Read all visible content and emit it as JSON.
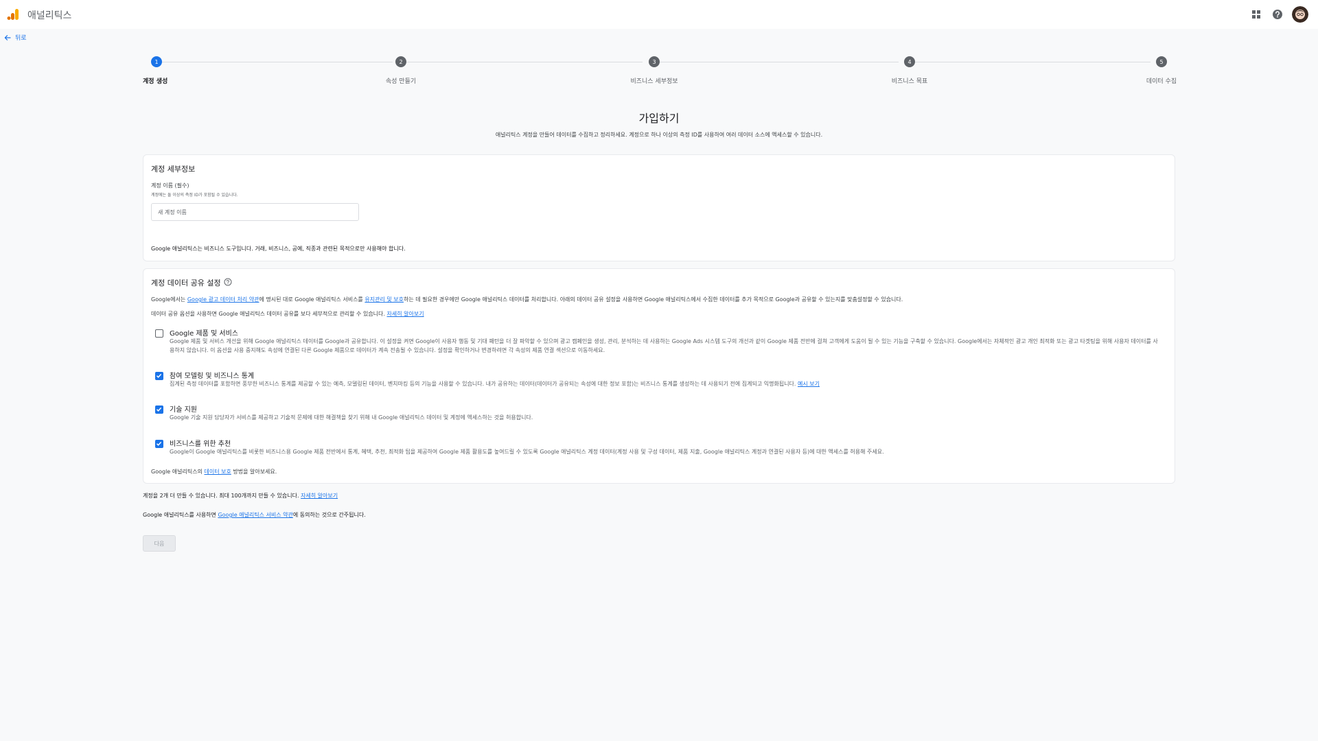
{
  "app": {
    "title": "애널리틱스"
  },
  "nav": {
    "back_label": "뒤로"
  },
  "steps": [
    {
      "number": "1",
      "label": "계정 생성",
      "active": true
    },
    {
      "number": "2",
      "label": "속성 만들기",
      "active": false
    },
    {
      "number": "3",
      "label": "비즈니스 세부정보",
      "active": false
    },
    {
      "number": "4",
      "label": "비즈니스 목표",
      "active": false
    },
    {
      "number": "5",
      "label": "데이터 수집",
      "active": false
    }
  ],
  "page": {
    "title": "가입하기",
    "subtitle": "애널리틱스 계정을 만들어 데이터를 수집하고 정리하세요. 계정으로 하나 이상의 측정 ID를 사용하여 여러 데이터 소스에 액세스할 수 있습니다."
  },
  "account_details": {
    "title": "계정 세부정보",
    "field_label": "계정 이름 (필수)",
    "field_hint": "계정에는 둘 이상의 측정 ID가 포함될 수 있습니다.",
    "field_value": "",
    "field_placeholder": "새 계정 이름",
    "note": "Google 애널리틱스는 비즈니스 도구입니다. 거래, 비즈니스, 공예, 직종과 관련된 목적으로만 사용해야 합니다."
  },
  "data_sharing": {
    "title": "계정 데이터 공유 설정",
    "intro_1_prefix": "Google에서는 ",
    "intro_1_link1": "Google 광고 데이터 처리 약관",
    "intro_1_mid": "에 명시된 대로 Google 애널리틱스 서비스를 ",
    "intro_1_link2": "유지관리 및 보호",
    "intro_1_suffix": "하는 데 필요한 경우에만 Google 애널리틱스 데이터를 처리합니다. 아래의 데이터 공유 설정을 사용하면 Google 애널리틱스에서 수집한 데이터를 추가 목적으로 Google과 공유할 수 있는지를 맞춤설정할 수 있습니다.",
    "intro_2_prefix": "데이터 공유 옵션을 사용하면 Google 애널리틱스 데이터 공유를 보다 세부적으로 관리할 수 있습니다. ",
    "intro_2_link": "자세히 알아보기",
    "options": [
      {
        "title": "Google 제품 및 서비스",
        "checked": false,
        "description": "Google 제품 및 서비스 개선을 위해 Google 애널리틱스 데이터를 Google과 공유합니다. 이 설정을 켜면 Google이 사용자 행동 및 기대 패턴을 더 잘 파악할 수 있으며 광고 캠페인을 생성, 관리, 분석하는 데 사용하는 Google Ads 시스템 도구의 개선과 같이 Google 제품 전반에 걸쳐 고객에게 도움이 될 수 있는 기능을 구축할 수 있습니다. Google에서는 자체적인 광고 개인 최적화 또는 광고 타겟팅을 위해 사용자 데이터를 사용하지 않습니다. 이 옵션을 사용 중지해도 속성에 연결된 다른 Google 제품으로 데이터가 계속 전송될 수 있습니다. 설정을 확인하거나 변경하려면 각 속성의 제품 연결 섹션으로 이동하세요.",
        "link": ""
      },
      {
        "title": "참여 모델링 및 비즈니스 통계",
        "checked": true,
        "description": "집계된 측정 데이터를 포함하면 풍부한 비즈니스 통계를 제공할 수 있는 예측, 모델링된 데이터, 벤치마킹 등의 기능을 사용할 수 있습니다. 내가 공유하는 데이터(데이터가 공유되는 속성에 대한 정보 포함)는 비즈니스 통계를 생성하는 데 사용되기 전에 집계되고 익명화됩니다. ",
        "link": "예시 보기"
      },
      {
        "title": "기술 지원",
        "checked": true,
        "description": "Google 기술 지원 담당자가 서비스를 제공하고 기술적 문제에 대한 해결책을 찾기 위해 내 Google 애널리틱스 데이터 및 계정에 액세스하는 것을 허용합니다.",
        "link": ""
      },
      {
        "title": "비즈니스를 위한 추천",
        "checked": true,
        "description": "Google이 Google 애널리틱스를 비롯한 비즈니스용 Google 제품 전반에서 통계, 혜택, 추천, 최적화 팁을 제공하여 Google 제품 활용도를 높여드릴 수 있도록 Google 애널리틱스 계정 데이터(계정 사용 및 구성 데이터, 제품 지출, Google 애널리틱스 계정과 연결된 사용자 등)에 대한 액세스를 허용해 주세요.",
        "link": ""
      }
    ],
    "protection_prefix": "Google 애널리틱스의 ",
    "protection_link": "데이터 보호",
    "protection_suffix": " 방법을 알아보세요."
  },
  "footer": {
    "limit_text": "계정을 2개 더 만들 수 있습니다. 최대 100개까지 만들 수 있습니다. ",
    "limit_link": "자세히 알아보기",
    "terms_prefix": "Google 애널리틱스를 사용하면 ",
    "terms_link": "Google 애널리틱스 서비스 약관",
    "terms_suffix": "에 동의하는 것으로 간주됩니다.",
    "next_label": "다음"
  },
  "colors": {
    "accent": "#1a73e8",
    "logo_orange_dark": "#e37400",
    "logo_orange_light": "#f9ab00"
  },
  "icons": {
    "logo": "analytics-logo-icon",
    "apps": "apps-grid-icon",
    "help": "help-circle-icon",
    "back": "arrow-left-icon",
    "check": "checkmark-icon"
  }
}
